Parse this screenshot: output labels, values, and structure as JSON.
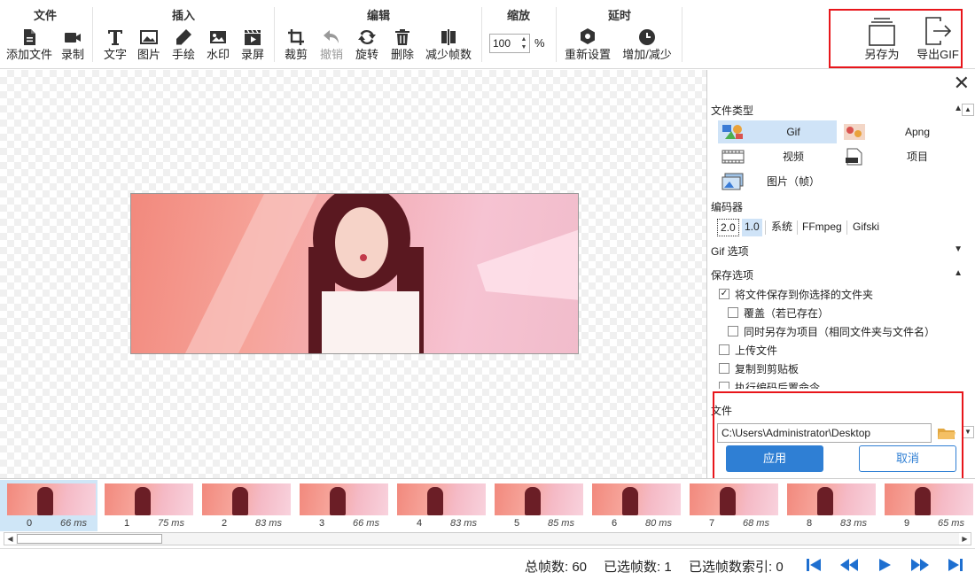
{
  "toolbar": {
    "groups": {
      "file": "文件",
      "insert": "插入",
      "edit": "编辑",
      "zoom": "缩放",
      "delay": "延时"
    },
    "buttons": {
      "add_file": "添加文件",
      "record": "录制",
      "text": "文字",
      "image": "图片",
      "freehand": "手绘",
      "watermark": "水印",
      "screen_record": "录屏",
      "crop": "裁剪",
      "undo": "撤销",
      "rotate": "旋转",
      "delete": "删除",
      "reduce_frames": "减少帧数",
      "reset": "重新设置",
      "increase_decrease": "增加/减少",
      "save_as": "另存为",
      "export_gif": "导出GIF"
    },
    "zoom_value": "100",
    "zoom_unit": "%"
  },
  "panel": {
    "file_type_label": "文件类型",
    "types": {
      "gif": "Gif",
      "apng": "Apng",
      "video": "视频",
      "project": "项目",
      "images": "图片（帧）"
    },
    "encoder_label": "编码器",
    "encoders": [
      "2.0",
      "1.0",
      "系统",
      "FFmpeg",
      "Gifski"
    ],
    "gif_options_label": "Gif 选项",
    "save_options_label": "保存选项",
    "options": {
      "save_to_folder": "将文件保存到你选择的文件夹",
      "overwrite": "覆盖（若已存在）",
      "save_project_too": "同时另存为项目（相同文件夹与文件名）",
      "upload": "上传文件",
      "copy_clipboard": "复制到剪贴板",
      "run_post_command": "执行编码后置命令"
    },
    "file_label": "文件",
    "path": "C:\\Users\\Administrator\\Desktop",
    "apply": "应用",
    "cancel": "取消"
  },
  "timeline": {
    "frames": [
      {
        "index": "0",
        "delay": "66 ms"
      },
      {
        "index": "1",
        "delay": "75 ms"
      },
      {
        "index": "2",
        "delay": "83 ms"
      },
      {
        "index": "3",
        "delay": "66 ms"
      },
      {
        "index": "4",
        "delay": "83 ms"
      },
      {
        "index": "5",
        "delay": "85 ms"
      },
      {
        "index": "6",
        "delay": "80 ms"
      },
      {
        "index": "7",
        "delay": "68 ms"
      },
      {
        "index": "8",
        "delay": "83 ms"
      },
      {
        "index": "9",
        "delay": "65 ms"
      }
    ],
    "selected_index": 0
  },
  "status": {
    "total_frames": "总帧数: 60",
    "selected_frames": "已选帧数: 1",
    "selected_index": "已选帧数索引: 0"
  },
  "colors": {
    "accent": "#2f7fd4",
    "highlight": "#e8161b",
    "selection": "#cfe3f7"
  }
}
